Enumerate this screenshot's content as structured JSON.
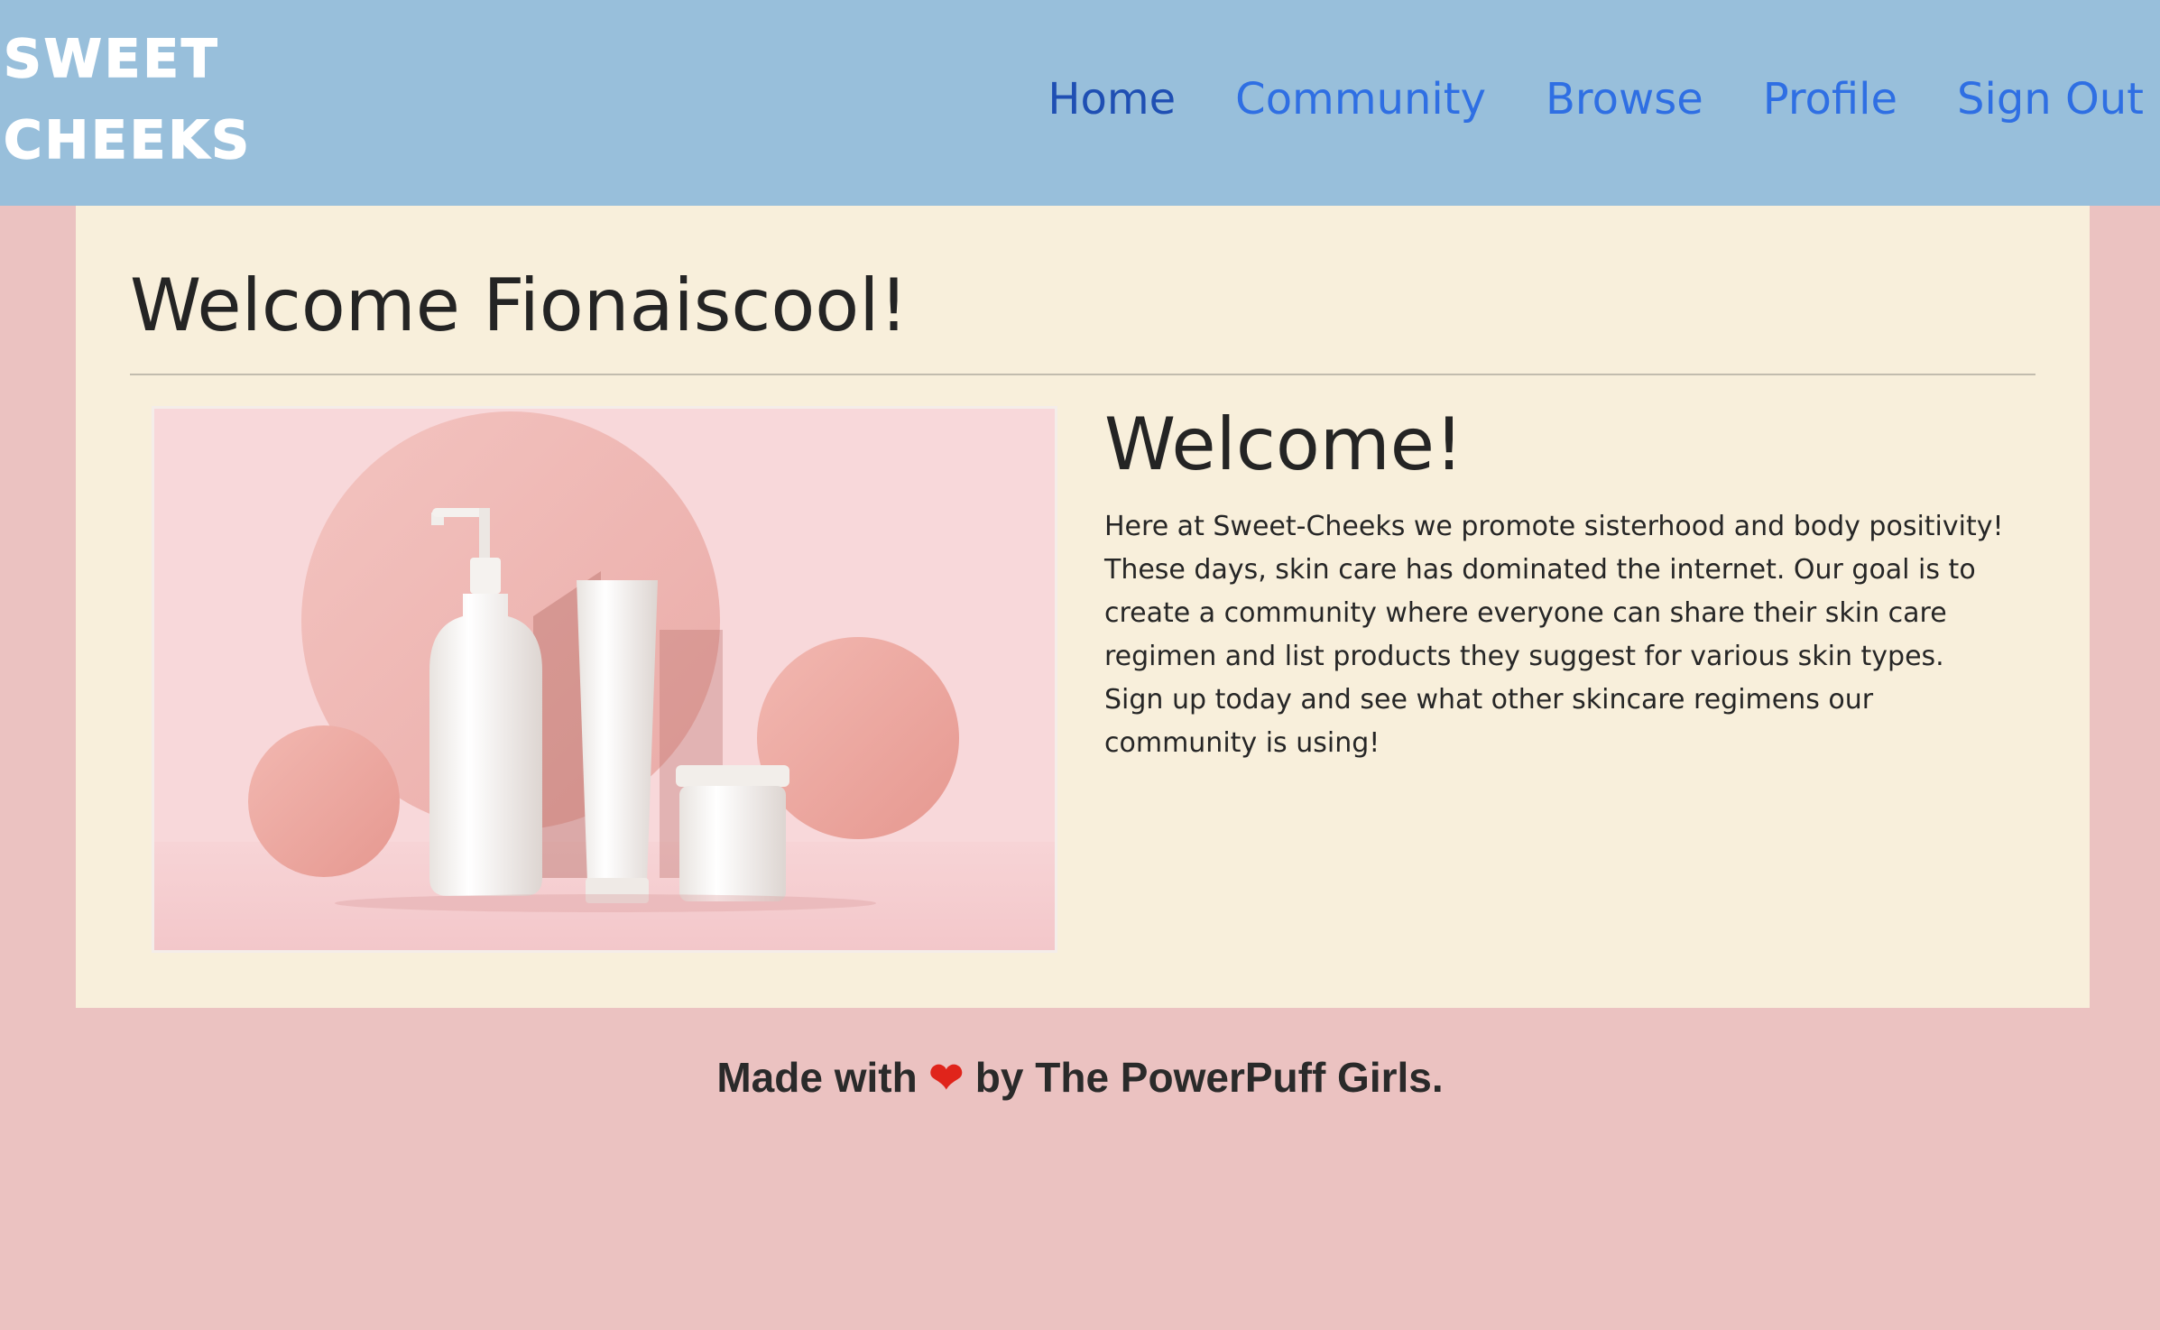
{
  "brand": {
    "line1": "SWEET",
    "line2": "CHEEKS"
  },
  "nav": {
    "items": [
      {
        "label": "Home"
      },
      {
        "label": "Community"
      },
      {
        "label": "Browse"
      },
      {
        "label": "Profile"
      },
      {
        "label": "Sign Out"
      }
    ]
  },
  "main": {
    "title": "Welcome Fionaiscool!",
    "image_icon": "skincare-products-image",
    "info_title": "Welcome!",
    "info_text": "Here at Sweet-Cheeks we promote sisterhood and body positivity! These days, skin care has dominated the internet. Our goal is to create a community where everyone can share their skin care regimen and list products they suggest for various skin types. Sign up today and see what other skincare regimens our community is using!"
  },
  "footer": {
    "prefix": "Made with",
    "heart": "❤",
    "suffix": "by The PowerPuff Girls."
  },
  "colors": {
    "navbar": "#98bfdb",
    "page_background": "#ebc2c1",
    "card_background": "#f8efdb",
    "link": "#2f6fe3",
    "text": "#242424"
  }
}
